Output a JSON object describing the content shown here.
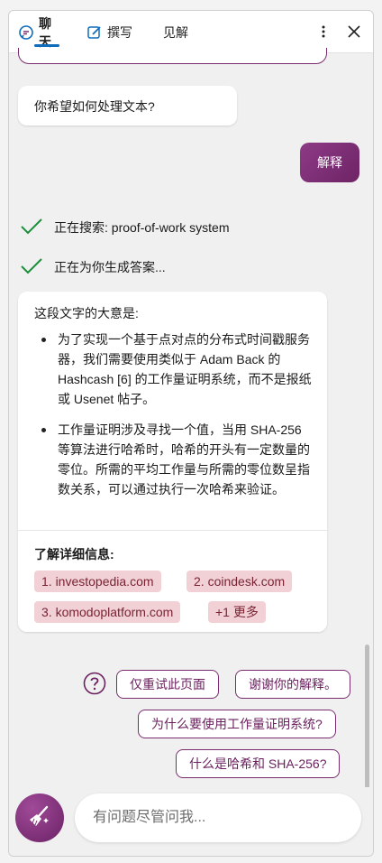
{
  "header": {
    "tabs": [
      {
        "label": "聊天",
        "icon": "chat-icon",
        "active": true
      },
      {
        "label": "撰写",
        "icon": "compose-icon",
        "active": false
      },
      {
        "label": "见解",
        "icon": "",
        "active": false
      }
    ]
  },
  "chat": {
    "question": "你希望如何处理文本?",
    "user_reply": "解释",
    "status_search": "正在搜索: proof-of-work system",
    "status_generating": "正在为你生成答案...",
    "answer": {
      "intro": "这段文字的大意是:",
      "bullets": [
        "为了实现一个基于点对点的分布式时间戳服务器，我们需要使用类似于 Adam Back 的 Hashcash [6] 的工作量证明系统，而不是报纸或 Usenet 帖子。",
        "工作量证明涉及寻找一个值，当用 SHA-256 等算法进行哈希时，哈希的开头有一定数量的零位。所需的平均工作量与所需的零位数呈指数关系，可以通过执行一次哈希来验证。"
      ],
      "learn_more_title": "了解详细信息:",
      "sources": [
        "1. investopedia.com",
        "2. coindesk.com",
        "3. komodoplatform.com"
      ],
      "more_label": "+1 更多"
    },
    "suggestions": [
      "仅重试此页面",
      "谢谢你的解释。",
      "为什么要使用工作量证明系统?",
      "什么是哈希和 SHA-256?"
    ]
  },
  "input": {
    "placeholder": "有问题尽管问我..."
  },
  "colors": {
    "accent": "#7a2d6e",
    "tab_underline": "#0f6cbd",
    "check": "#1a8f3a",
    "chip_bg": "#f1d1d6"
  }
}
